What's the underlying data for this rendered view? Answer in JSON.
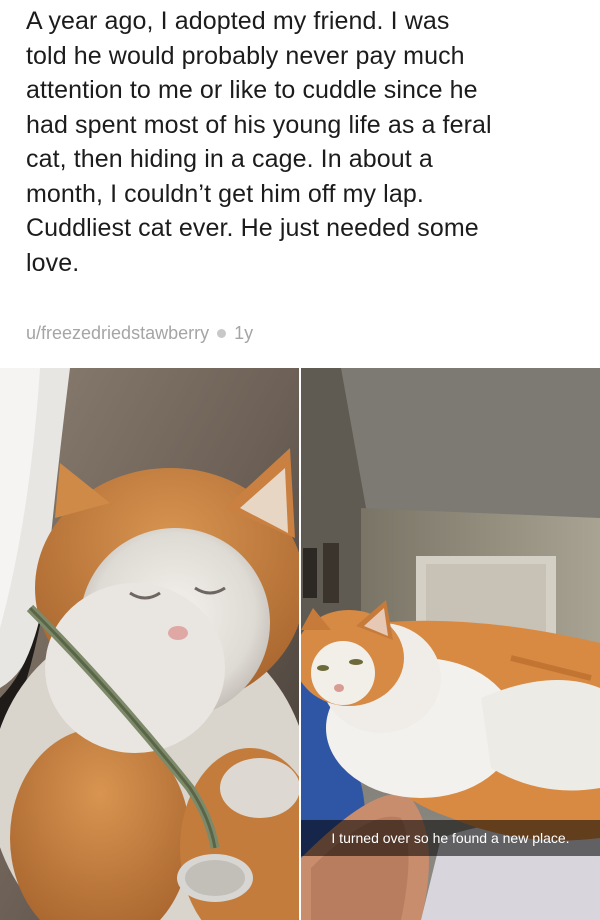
{
  "post": {
    "body_lines": [
      "A year ago, I adopted my friend. I was",
      "told he would probably never pay much",
      "attention to me or like to cuddle since he",
      "had spent most of his young life as a feral",
      "cat, then hiding in a cage. In about a",
      "month, I couldn’t get him off my lap.",
      "Cuddliest cat ever. He just needed some",
      "love."
    ],
    "author": "u/freezedriedstawberry",
    "age": "1y"
  },
  "photos": {
    "left": {
      "subject": "sleeping orange and white cat"
    },
    "right": {
      "subject": "orange and white cat lying on person's shoulder",
      "caption": "I turned over so he found a new place."
    }
  },
  "colors": {
    "text": "#1c1c1c",
    "meta": "#a5a5a5",
    "cat_orange": "#d58b45",
    "cat_white": "#f2efe9"
  }
}
